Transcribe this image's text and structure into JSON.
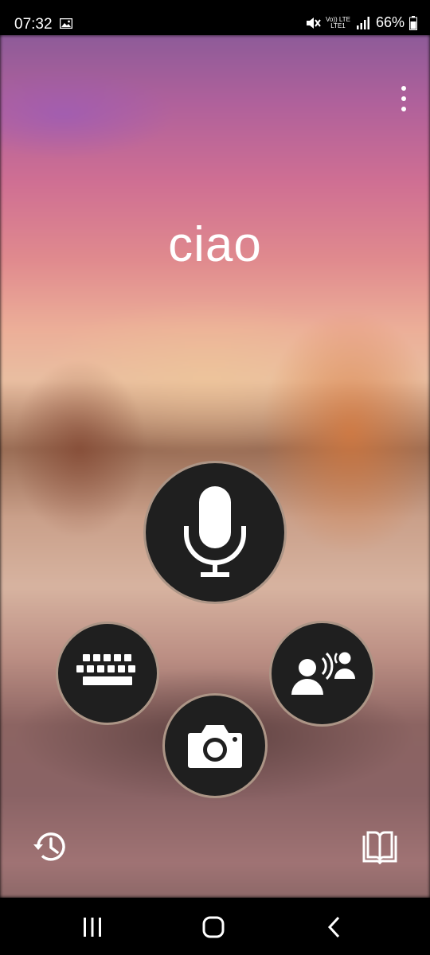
{
  "status_bar": {
    "time": "07:32",
    "net_top": "Vo)) LTE",
    "net_bottom": "LTE1",
    "battery": "66%"
  },
  "main": {
    "phrase": "ciao"
  },
  "icons": {
    "menu": "more-vert-icon",
    "mic": "microphone-icon",
    "keyboard": "keyboard-icon",
    "camera": "camera-icon",
    "conversation": "conversation-icon",
    "history": "history-icon",
    "phrasebook": "book-icon",
    "nav_recent": "recent-apps-icon",
    "nav_home": "home-icon",
    "nav_back": "back-icon"
  },
  "colors": {
    "button_fill": "#1f1f1f",
    "button_ring": "#dcbeaa",
    "icon": "#ffffff"
  }
}
